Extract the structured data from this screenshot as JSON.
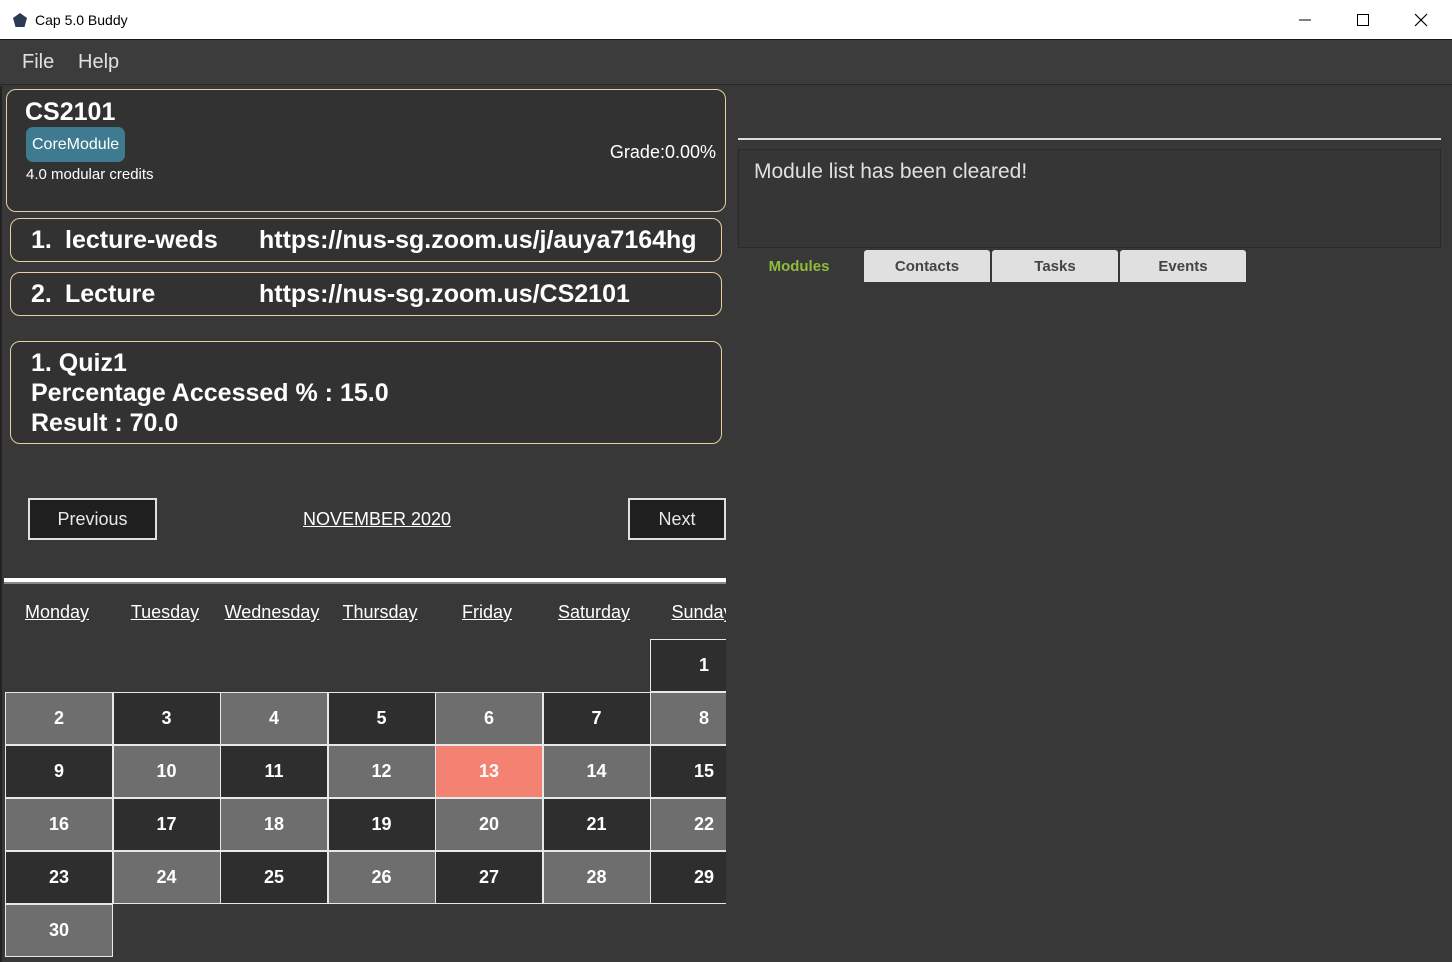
{
  "window": {
    "title": "Cap 5.0 Buddy"
  },
  "menu": {
    "file": "File",
    "help": "Help"
  },
  "module": {
    "code": "CS2101",
    "tag": "CoreModule",
    "credits": "4.0 modular credits",
    "grade": "Grade:0.00%"
  },
  "links": [
    {
      "index": "1.",
      "name": "lecture-weds",
      "url": "https://nus-sg.zoom.us/j/auya7164hg"
    },
    {
      "index": "2.",
      "name": "Lecture",
      "url": "https://nus-sg.zoom.us/CS2101"
    }
  ],
  "assessment": {
    "title": "1.  Quiz1",
    "percentage": "Percentage Accessed % : 15.0",
    "result": "Result : 70.0"
  },
  "calendar": {
    "prev_label": "Previous",
    "next_label": "Next",
    "month": "NOVEMBER 2020",
    "weekdays": [
      "Monday",
      "Tuesday",
      "Wednesday",
      "Thursday",
      "Friday",
      "Saturday",
      "Sunday"
    ],
    "days": [
      "1",
      "2",
      "3",
      "4",
      "5",
      "6",
      "7",
      "8",
      "9",
      "10",
      "11",
      "12",
      "13",
      "14",
      "15",
      "16",
      "17",
      "18",
      "19",
      "20",
      "21",
      "22",
      "23",
      "24",
      "25",
      "26",
      "27",
      "28",
      "29",
      "30"
    ],
    "highlighted_day": "13",
    "colors": {
      "light": "#6e6e6e",
      "dark": "#2e2e2e",
      "today": "#f38272"
    }
  },
  "result_display": {
    "message": "Module list has been cleared!"
  },
  "tabs": [
    {
      "label": "Modules",
      "active": true
    },
    {
      "label": "Contacts",
      "active": false
    },
    {
      "label": "Tasks",
      "active": false
    },
    {
      "label": "Events",
      "active": false
    }
  ],
  "colors": {
    "card_border": "#e6cfa0",
    "tag_bg": "#3e7b91",
    "active_tab": "#8fbc3c"
  }
}
